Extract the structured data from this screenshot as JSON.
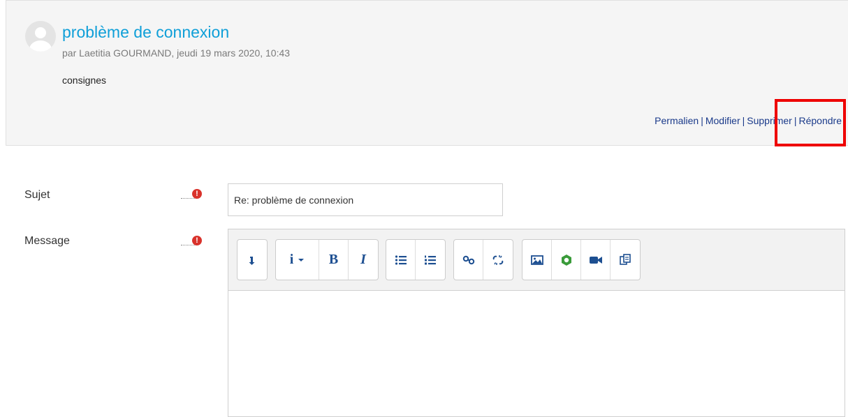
{
  "post": {
    "title": "problème de connexion",
    "meta": "par Laetitia GOURMAND, jeudi 19 mars 2020, 10:43",
    "body": "consignes",
    "actions": {
      "permalink": "Permalien",
      "edit": "Modifier",
      "delete": "Supprimer",
      "reply": "Répondre",
      "separator": "|"
    }
  },
  "form": {
    "subject_label": "Sujet",
    "subject_value": "Re: problème de connexion",
    "message_label": "Message",
    "required_icon": "!"
  },
  "toolbar": {
    "icons": [
      "collapse-icon",
      "paragraph-style-icon",
      "bold-icon",
      "italic-icon",
      "unordered-list-icon",
      "ordered-list-icon",
      "link-icon",
      "unlink-icon",
      "image-icon",
      "recordrtc-icon",
      "video-icon",
      "manage-files-icon"
    ],
    "bold_label": "B",
    "italic_label": "I",
    "info_label": "i"
  },
  "colors": {
    "title": "#0f9fd8",
    "action_links": "#1a3a8a",
    "highlight_box": "#ee0000",
    "required": "#d9322b",
    "toolbar_icons": "#1d4f91"
  }
}
